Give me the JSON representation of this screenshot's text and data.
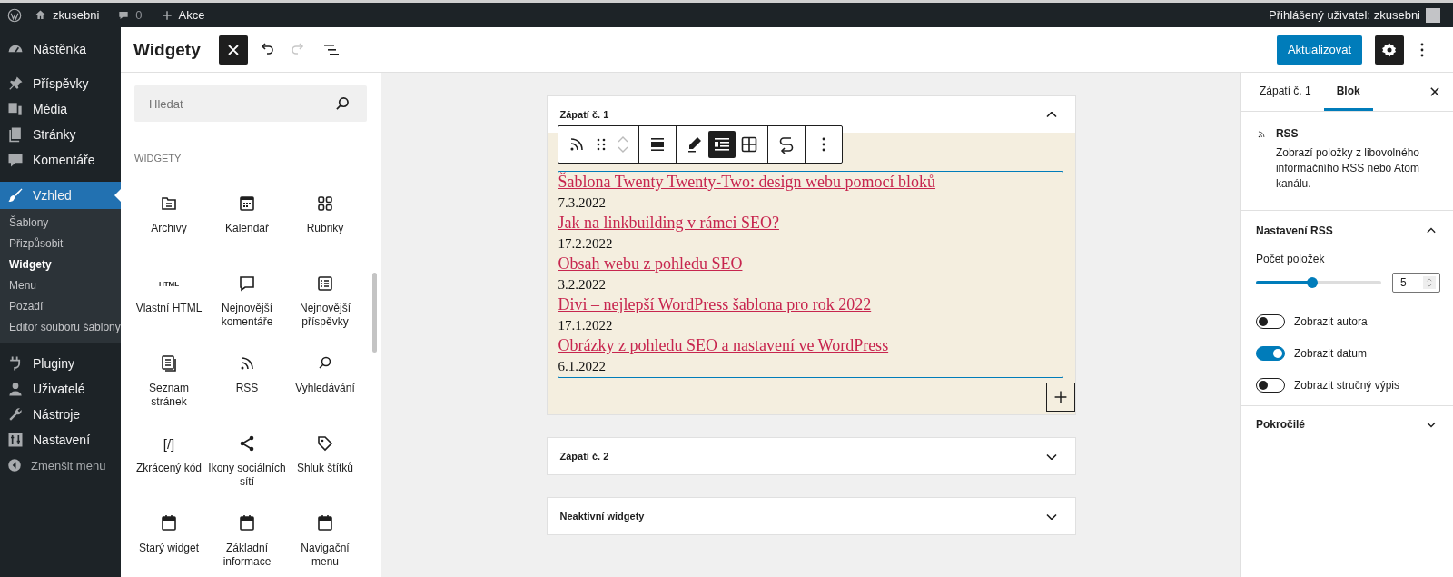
{
  "admin_bar": {
    "site": "zkusebni",
    "comments": "0",
    "new": "Akce",
    "user": "Přihlášený uživatel: zkusebni"
  },
  "admin_menu": {
    "items": [
      {
        "label": "Nástěnka",
        "selected": false
      },
      {
        "label": "Příspěvky",
        "selected": false
      },
      {
        "label": "Média",
        "selected": false
      },
      {
        "label": "Stránky",
        "selected": false
      },
      {
        "label": "Komentáře",
        "selected": false
      },
      {
        "label": "Vzhled",
        "selected": true,
        "children": [
          {
            "label": "Šablony",
            "selected": false
          },
          {
            "label": "Přizpůsobit",
            "selected": false
          },
          {
            "label": "Widgety",
            "selected": true
          },
          {
            "label": "Menu",
            "selected": false
          },
          {
            "label": "Pozadí",
            "selected": false
          },
          {
            "label": "Editor souboru šablony",
            "selected": false
          }
        ]
      },
      {
        "label": "Pluginy",
        "selected": false
      },
      {
        "label": "Uživatelé",
        "selected": false
      },
      {
        "label": "Nástroje",
        "selected": false
      },
      {
        "label": "Nastavení",
        "selected": false
      }
    ],
    "collapse": "Zmenšit menu"
  },
  "editor_header": {
    "title": "Widgety",
    "tools": [
      {
        "kind": "close",
        "pressed": true,
        "disabled": false
      },
      {
        "kind": "undo",
        "pressed": false,
        "disabled": false
      },
      {
        "kind": "redo",
        "pressed": false,
        "disabled": true
      },
      {
        "kind": "list_view",
        "pressed": false,
        "disabled": false
      }
    ],
    "update_button": "Aktualizovat",
    "settings_pressed": true
  },
  "inserter": {
    "search": {
      "placeholder": "Hledat"
    },
    "category": "WIDGETY",
    "blocks": [
      {
        "label": "Archivy"
      },
      {
        "label": "Kalendář"
      },
      {
        "label": "Rubriky"
      },
      {
        "label": "Vlastní HTML",
        "glyph": "HTML"
      },
      {
        "label": "Nejnovější komentáře"
      },
      {
        "label": "Nejnovější příspěvky"
      },
      {
        "label": "Seznam stránek"
      },
      {
        "label": "RSS"
      },
      {
        "label": "Vyhledávání"
      },
      {
        "label": "Zkrácený kód",
        "glyph": "[/]"
      },
      {
        "label": "Ikony sociálních sítí"
      },
      {
        "label": "Shluk štítků"
      },
      {
        "label": "Starý widget"
      },
      {
        "label": "Základní informace"
      },
      {
        "label": "Navigační menu"
      }
    ]
  },
  "widget_areas": [
    {
      "title": "Zápatí č. 1",
      "expanded": true,
      "toolbar": [
        [
          {
            "kind": "rss",
            "pressed": false
          },
          {
            "kind": "drag",
            "pressed": false
          },
          {
            "kind": "mover",
            "pressed": false
          }
        ],
        [
          {
            "kind": "align",
            "pressed": false
          }
        ],
        [
          {
            "kind": "edit",
            "pressed": false
          },
          {
            "kind": "list",
            "pressed": true
          },
          {
            "kind": "grid",
            "pressed": false
          }
        ],
        [
          {
            "kind": "transform",
            "pressed": false
          }
        ],
        [
          {
            "kind": "more",
            "pressed": false
          }
        ]
      ],
      "rss_items": [
        {
          "title": "Šablona Twenty Twenty-Two: design webu pomocí bloků",
          "date": "7.3.2022"
        },
        {
          "title": "Jak na linkbuilding v rámci SEO?",
          "date": "17.2.2022"
        },
        {
          "title": "Obsah webu z pohledu SEO",
          "date": "3.2.2022"
        },
        {
          "title": "Divi – nejlepší WordPress šablona pro rok 2022",
          "date": "17.1.2022"
        },
        {
          "title": "Obrázky z pohledu SEO a nastavení ve WordPress",
          "date": "6.1.2022"
        }
      ]
    },
    {
      "title": "Zápatí č. 2",
      "expanded": false
    },
    {
      "title": "Neaktivní widgety",
      "expanded": false
    }
  ],
  "inspector": {
    "tabs": [
      {
        "label": "Zápatí č. 1",
        "selected": false
      },
      {
        "label": "Blok",
        "selected": true
      }
    ],
    "block": {
      "title": "RSS",
      "description": "Zobrazí položky z libovolného informačního RSS nebo Atom kanálu."
    },
    "panels": [
      {
        "title": "Nastavení RSS",
        "expanded": true,
        "range": {
          "label": "Počet položek",
          "level": 0.45,
          "value": "5"
        },
        "toggles": [
          {
            "label": "Zobrazit autora",
            "on": false
          },
          {
            "label": "Zobrazit datum",
            "on": true
          },
          {
            "label": "Zobrazit stručný výpis",
            "on": false
          }
        ]
      },
      {
        "title": "Pokročilé",
        "expanded": false
      }
    ]
  }
}
